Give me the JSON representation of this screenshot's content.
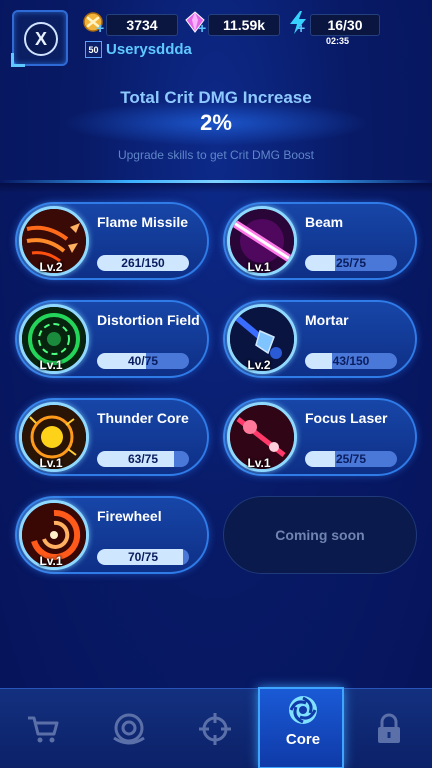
{
  "header": {
    "gold": "3734",
    "gems": "11.59k",
    "energy": "16/30",
    "energy_timer": "02:35",
    "player_level": "50",
    "username": "Userysddda",
    "plus": "+"
  },
  "crit": {
    "title": "Total Crit DMG Increase",
    "value": "2%",
    "subtitle": "Upgrade skills to get Crit DMG Boost"
  },
  "skills": [
    {
      "name": "Flame Missile",
      "level": "Lv.2",
      "progress": "261/150",
      "fill": 1.0
    },
    {
      "name": "Beam",
      "level": "Lv.1",
      "progress": "25/75",
      "fill": 0.33
    },
    {
      "name": "Distortion Field",
      "level": "Lv.1",
      "progress": "40/75",
      "fill": 0.53
    },
    {
      "name": "Mortar",
      "level": "Lv.2",
      "progress": "43/150",
      "fill": 0.29
    },
    {
      "name": "Thunder Core",
      "level": "Lv.1",
      "progress": "63/75",
      "fill": 0.84
    },
    {
      "name": "Focus Laser",
      "level": "Lv.1",
      "progress": "25/75",
      "fill": 0.33
    },
    {
      "name": "Firewheel",
      "level": "Lv.1",
      "progress": "70/75",
      "fill": 0.93
    }
  ],
  "coming_soon": "Coming soon",
  "nav": {
    "items": [
      {
        "icon": "cart-icon"
      },
      {
        "icon": "radar-icon"
      },
      {
        "icon": "crosshair-icon"
      },
      {
        "icon": "core-icon",
        "label": "Core"
      },
      {
        "icon": "lock-icon"
      }
    ]
  },
  "colors": {
    "accent": "#3ea6ff",
    "text_blue": "#8ec9ff",
    "username": "#5ec8ff"
  }
}
